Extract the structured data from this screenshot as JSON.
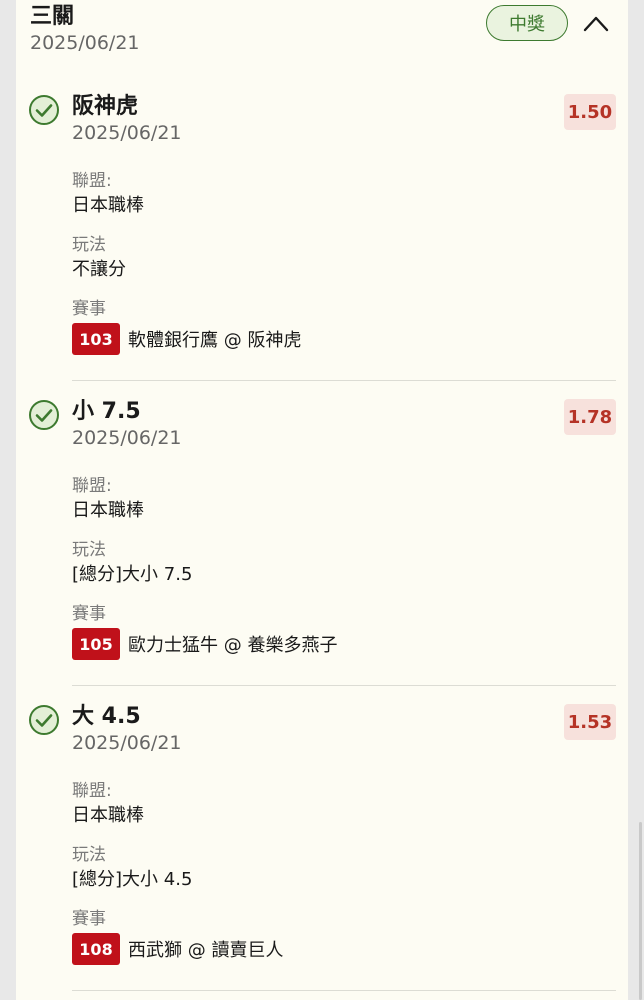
{
  "header": {
    "title": "三關",
    "date": "2025/06/21",
    "status_label": "中獎"
  },
  "labels": {
    "league": "聯盟:",
    "bet_type": "玩法",
    "match": "賽事"
  },
  "bets": [
    {
      "title": "阪神虎",
      "date": "2025/06/21",
      "odds": "1.50",
      "league": "日本職棒",
      "bet_type": "不讓分",
      "match_id": "103",
      "match_name": "軟體銀行鷹 @ 阪神虎"
    },
    {
      "title": "小 7.5",
      "date": "2025/06/21",
      "odds": "1.78",
      "league": "日本職棒",
      "bet_type": "[總分]大小 7.5",
      "match_id": "105",
      "match_name": "歐力士猛牛 @ 養樂多燕子"
    },
    {
      "title": "大 4.5",
      "date": "2025/06/21",
      "odds": "1.53",
      "league": "日本職棒",
      "bet_type": "[總分]大小 4.5",
      "match_id": "108",
      "match_name": "西武獅 @ 讀賣巨人"
    }
  ],
  "colors": {
    "status_green": "#3d7a2f",
    "odds_red": "#b53326",
    "match_badge_red": "#c0111a",
    "card_background": "#fdfcf3"
  },
  "icons": {
    "collapse": "chevron-up-icon",
    "won": "check-circle-icon"
  }
}
